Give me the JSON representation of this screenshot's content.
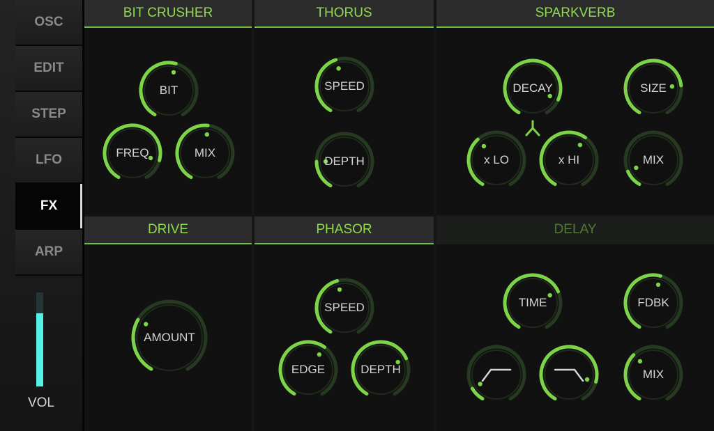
{
  "sidebar": {
    "items": [
      {
        "label": "OSC",
        "active": false
      },
      {
        "label": "EDIT",
        "active": false
      },
      {
        "label": "STEP",
        "active": false
      },
      {
        "label": "LFO",
        "active": false
      },
      {
        "label": "FX",
        "active": true
      },
      {
        "label": "ARP",
        "active": false
      }
    ],
    "volume": {
      "label": "VOL",
      "level": 0.78
    }
  },
  "colors": {
    "accent": "#6fbe3c",
    "arc_track": "#263a22",
    "arc_value": "#7ed448",
    "knob_face": "#101010",
    "volume": "#55f0e6"
  },
  "panels": {
    "bit_crusher": {
      "title": "BIT CRUSHER",
      "knobs": {
        "bit": {
          "label": "BIT",
          "value": 0.55
        },
        "freq": {
          "label": "FREQ",
          "value": 0.85
        },
        "mix": {
          "label": "MIX",
          "value": 0.52
        }
      }
    },
    "thorus": {
      "title": "THORUS",
      "knobs": {
        "speed": {
          "label": "SPEED",
          "value": 0.44
        },
        "depth": {
          "label": "DEPTH",
          "value": 0.2
        }
      }
    },
    "sparkverb": {
      "title": "SPARKVERB",
      "knobs": {
        "decay": {
          "label": "DECAY",
          "value": 0.88
        },
        "size": {
          "label": "SIZE",
          "value": 0.78
        },
        "x_lo": {
          "label": "x LO",
          "value": 0.36
        },
        "x_hi": {
          "label": "x HI",
          "value": 0.62
        },
        "mix": {
          "label": "MIX",
          "value": 0.12
        }
      }
    },
    "drive": {
      "title": "DRIVE",
      "knobs": {
        "amount": {
          "label": "AMOUNT",
          "value": 0.3
        }
      }
    },
    "phasor": {
      "title": "PHASOR",
      "knobs": {
        "speed": {
          "label": "SPEED",
          "value": 0.45
        },
        "edge": {
          "label": "EDGE",
          "value": 0.62
        },
        "depth": {
          "label": "DEPTH",
          "value": 0.72
        }
      }
    },
    "delay": {
      "title": "DELAY",
      "enabled": false,
      "knobs": {
        "time": {
          "label": "TIME",
          "value": 0.72
        },
        "fdbk": {
          "label": "FDBK",
          "value": 0.55
        },
        "low_cut": {
          "icon": "high-pass-filter-icon",
          "value": 0.1
        },
        "high_cut": {
          "icon": "low-pass-filter-icon",
          "value": 0.85
        },
        "mix": {
          "label": "MIX",
          "value": 0.35
        }
      }
    }
  }
}
